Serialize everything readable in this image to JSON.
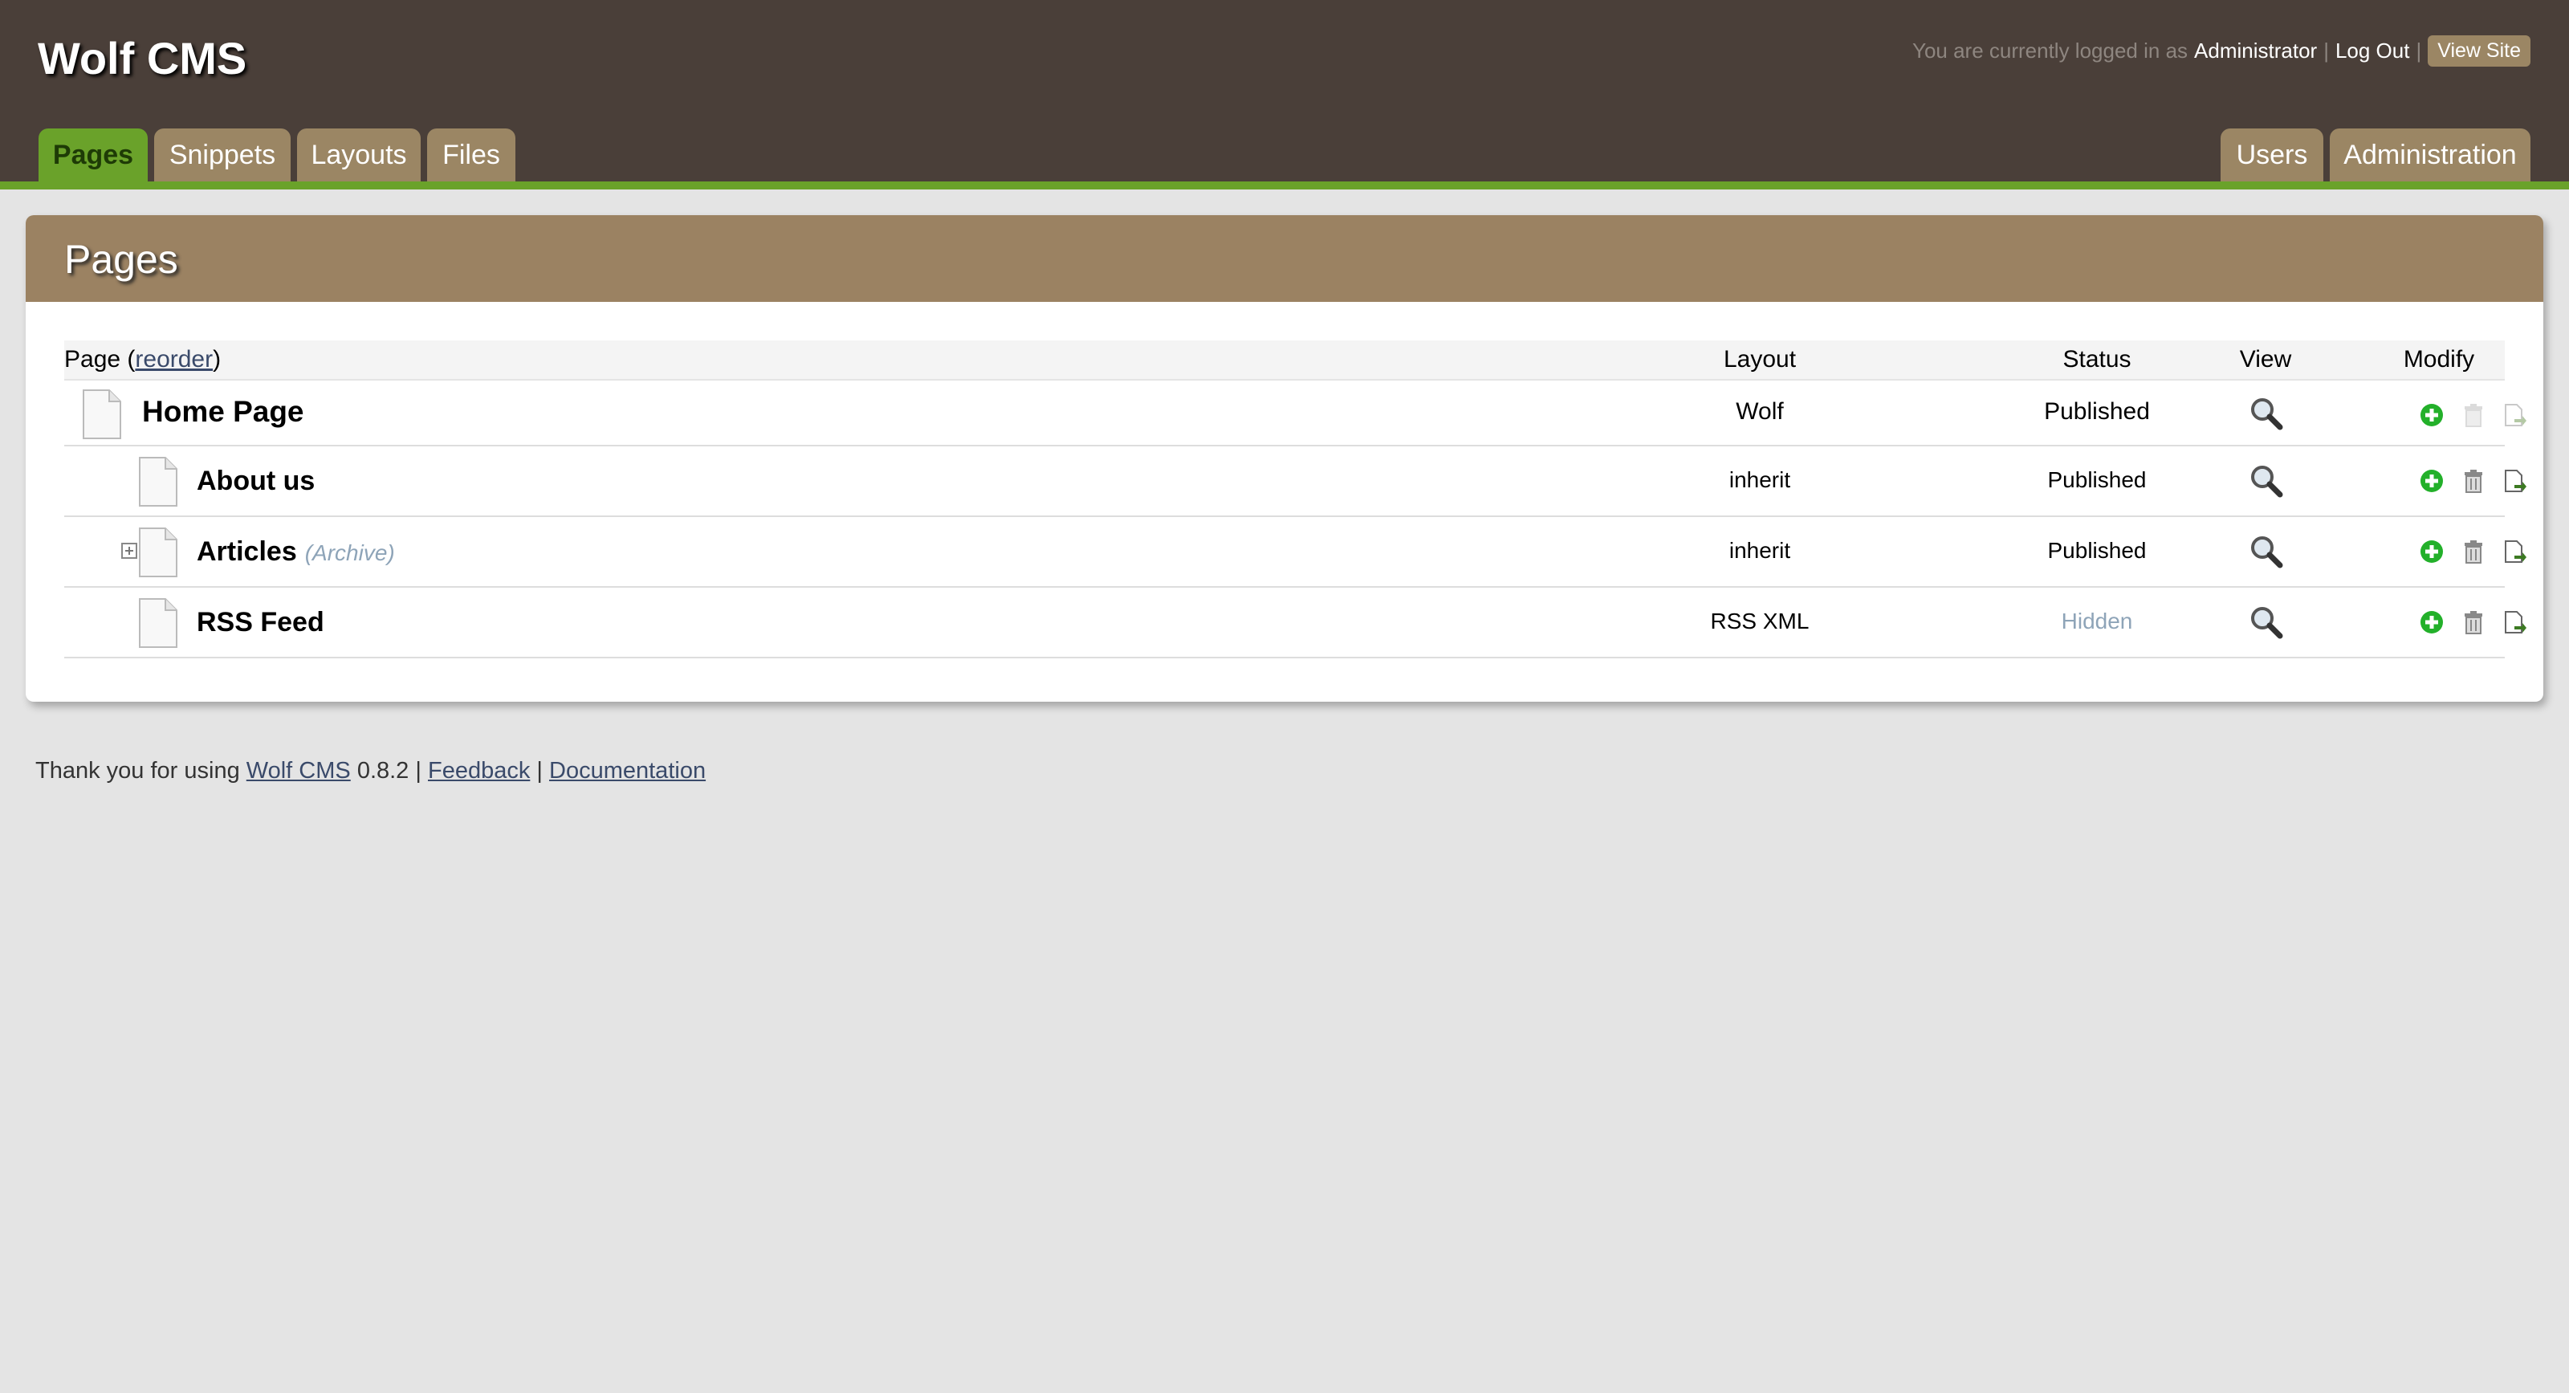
{
  "header": {
    "site_title": "Wolf CMS",
    "login_prefix": "You are currently logged in as",
    "user": "Administrator",
    "sep": "|",
    "logout": "Log Out",
    "view_site": "View Site"
  },
  "nav": {
    "left_tabs": [
      "Pages",
      "Snippets",
      "Layouts",
      "Files"
    ],
    "right_tabs": [
      "Users",
      "Administration"
    ],
    "active": "Pages"
  },
  "panel": {
    "title": "Pages",
    "columns": {
      "page_prefix": "Page (",
      "reorder": "reorder",
      "page_suffix": ")",
      "layout": "Layout",
      "status": "Status",
      "view": "View",
      "modify": "Modify"
    },
    "rows": [
      {
        "name": "Home Page",
        "note": "",
        "layout": "Wolf",
        "status": "Published"
      },
      {
        "name": "About us",
        "note": "",
        "layout": "inherit",
        "status": "Published"
      },
      {
        "name": "Articles",
        "note": "(Archive)",
        "layout": "inherit",
        "status": "Published"
      },
      {
        "name": "RSS Feed",
        "note": "",
        "layout": "RSS XML",
        "status": "Hidden"
      }
    ]
  },
  "footer": {
    "prefix": "Thank you for using",
    "cms_link": "Wolf CMS",
    "version": "0.8.2",
    "sep": "|",
    "feedback": "Feedback",
    "documentation": "Documentation"
  },
  "icons": {
    "document": "document-icon",
    "view": "magnifier-icon",
    "add": "add-child-icon",
    "delete": "trash-icon",
    "copy": "copy-page-icon",
    "expand": "expand-plus-icon"
  },
  "colors": {
    "header_bg": "#4a3f39",
    "accent_green": "#6aa22a",
    "tab_brown": "#9b8664",
    "panel_head": "#9b8262",
    "page_bg": "#e4e4e4"
  }
}
